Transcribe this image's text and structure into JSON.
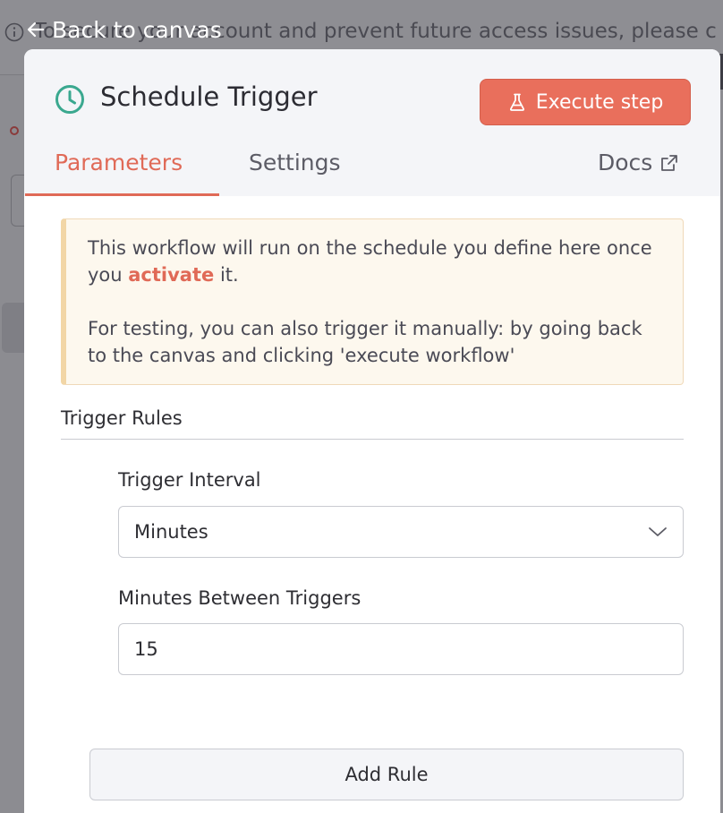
{
  "background": {
    "banner_text": "To secure your account and prevent future access issues, please c"
  },
  "back_link": {
    "label": "Back to canvas"
  },
  "node": {
    "title": "Schedule Trigger",
    "icon": "clock-icon",
    "execute_label": "Execute step"
  },
  "tabs": {
    "parameters": "Parameters",
    "settings": "Settings",
    "docs": "Docs"
  },
  "notice": {
    "line1_before": "This workflow will run on the schedule you define here once you ",
    "link": "activate",
    "line1_after": " it.",
    "line2": "For testing, you can also trigger it manually: by going back to the canvas and clicking 'execute workflow'"
  },
  "trigger_rules": {
    "title": "Trigger Rules",
    "interval_label": "Trigger Interval",
    "interval_value": "Minutes",
    "minutes_label": "Minutes Between Triggers",
    "minutes_value": "15",
    "add_rule": "Add Rule"
  },
  "colors": {
    "accent": "#e96f5c",
    "icon_teal": "#3aa88f",
    "notice_bg": "#fdf8ee",
    "notice_border": "#f2d6a6"
  }
}
